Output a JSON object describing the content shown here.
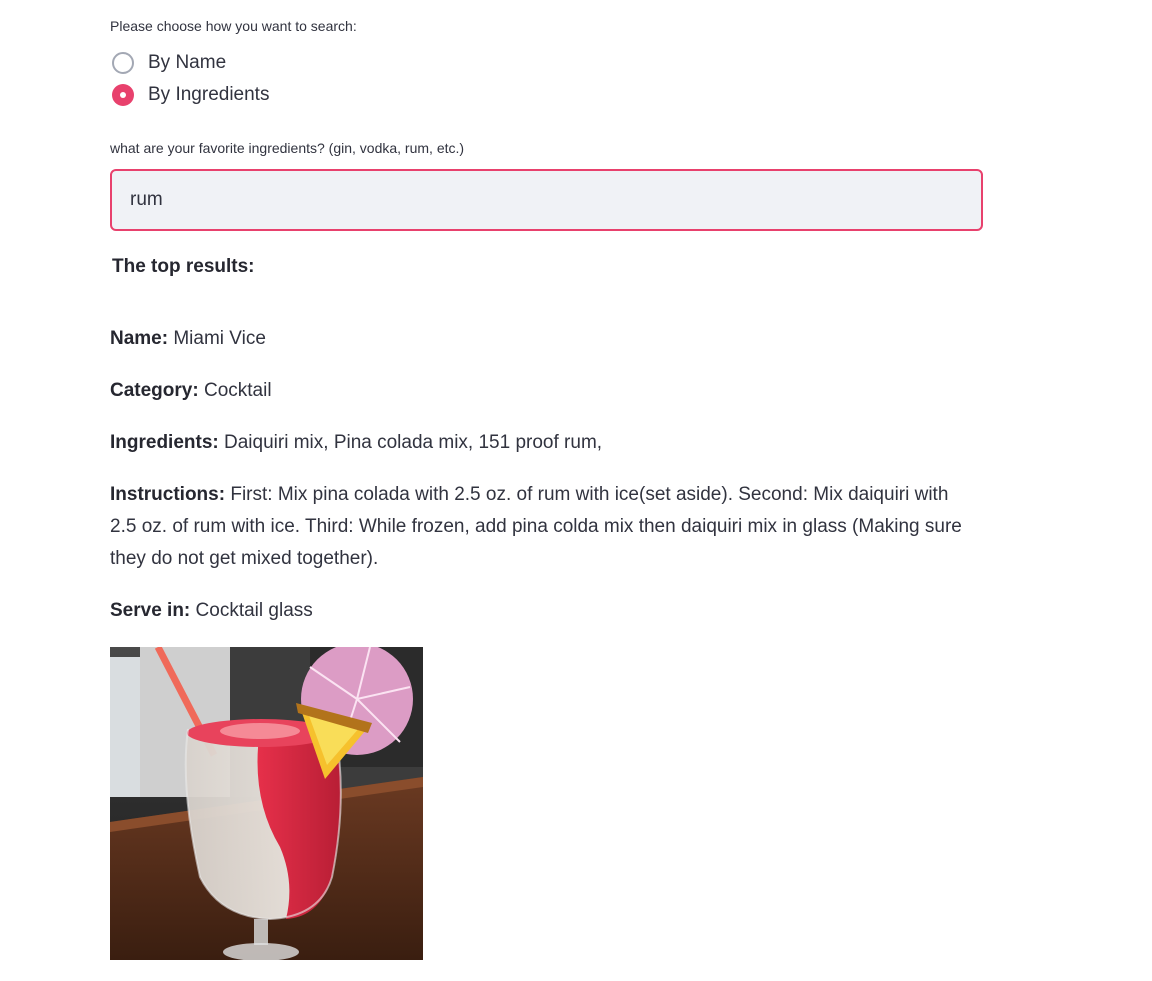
{
  "search_mode": {
    "label": "Please choose how you want to search:",
    "options": [
      "By Name",
      "By Ingredients"
    ],
    "selected": "By Ingredients"
  },
  "ingredient_search": {
    "label": "what are your favorite ingredients? (gin, vodka, rum, etc.)",
    "value": "rum"
  },
  "results": {
    "heading": "The top results:",
    "item": {
      "name_label": "Name:",
      "name": "Miami Vice",
      "category_label": "Category:",
      "category": "Cocktail",
      "ingredients_label": "Ingredients:",
      "ingredients": "Daiquiri mix, Pina colada mix, 151 proof rum,",
      "instructions_label": "Instructions:",
      "instructions": "First: Mix pina colada with 2.5 oz. of rum with ice(set aside). Second: Mix daiquiri with 2.5 oz. of rum with ice. Third: While frozen, add pina colda mix then daiquiri mix in glass (Making sure they do not get mixed together).",
      "serve_label": "Serve in:",
      "glass": "Cocktail glass"
    }
  },
  "colors": {
    "accent": "#e8416d",
    "input_bg": "#f0f2f6",
    "text": "#31333f"
  }
}
